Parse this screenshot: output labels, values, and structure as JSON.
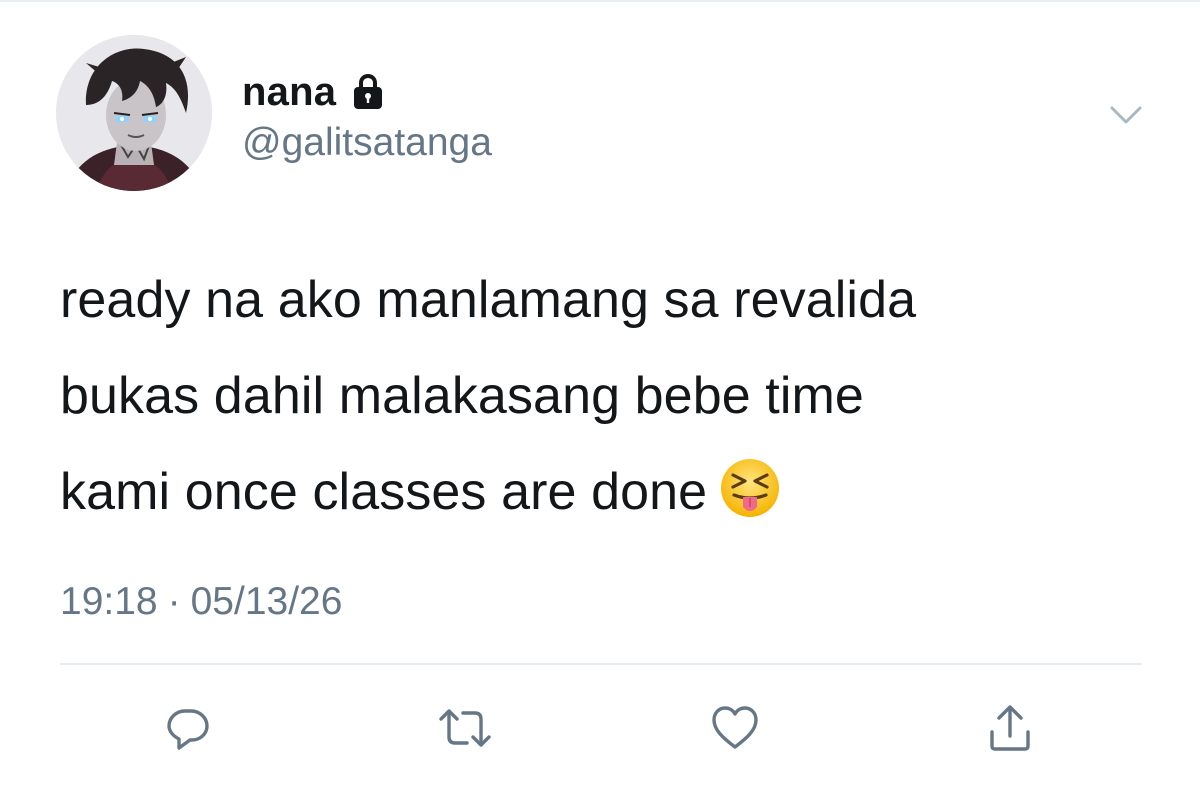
{
  "user": {
    "display_name": "nana",
    "handle": "@galitsatanga",
    "protected_icon": "lock-icon",
    "avatar": "avatar"
  },
  "tweet": {
    "lines": [
      "ready na ako manlamang sa revalida",
      "bukas dahil malakasang bebe time",
      "kami once classes are done"
    ],
    "emoji": "squinting-face-with-tongue"
  },
  "meta": {
    "time": "19:18",
    "separator": "·",
    "date": "05/13/26"
  },
  "actions": {
    "reply_icon": "reply-icon",
    "retweet_icon": "retweet-icon",
    "like_icon": "heart-icon",
    "share_icon": "share-icon",
    "more_icon": "chevron-down-icon"
  },
  "colors": {
    "text_primary": "#14171a",
    "text_secondary": "#657786",
    "icon": "#657786",
    "divider": "#e6ecf0"
  }
}
